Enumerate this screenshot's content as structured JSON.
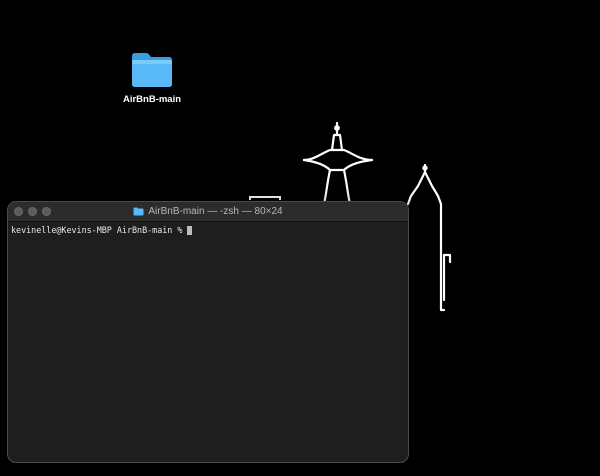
{
  "desktop": {
    "background_color": "#000000",
    "wallpaper": "seattle-skyline-line-art",
    "icons": [
      {
        "label": "AirBnB-main",
        "icon": "folder-icon",
        "color": "#4fb6f5"
      }
    ]
  },
  "terminal": {
    "title": "AirBnB-main — -zsh — 80×24",
    "title_icon": "folder-icon",
    "traffic_lights": [
      "close",
      "minimize",
      "zoom"
    ],
    "prompt": "kevinelle@Kevins-MBP AirBnB-main %",
    "background_color": "#1e1e1e",
    "text_color": "#e6e6e6"
  }
}
